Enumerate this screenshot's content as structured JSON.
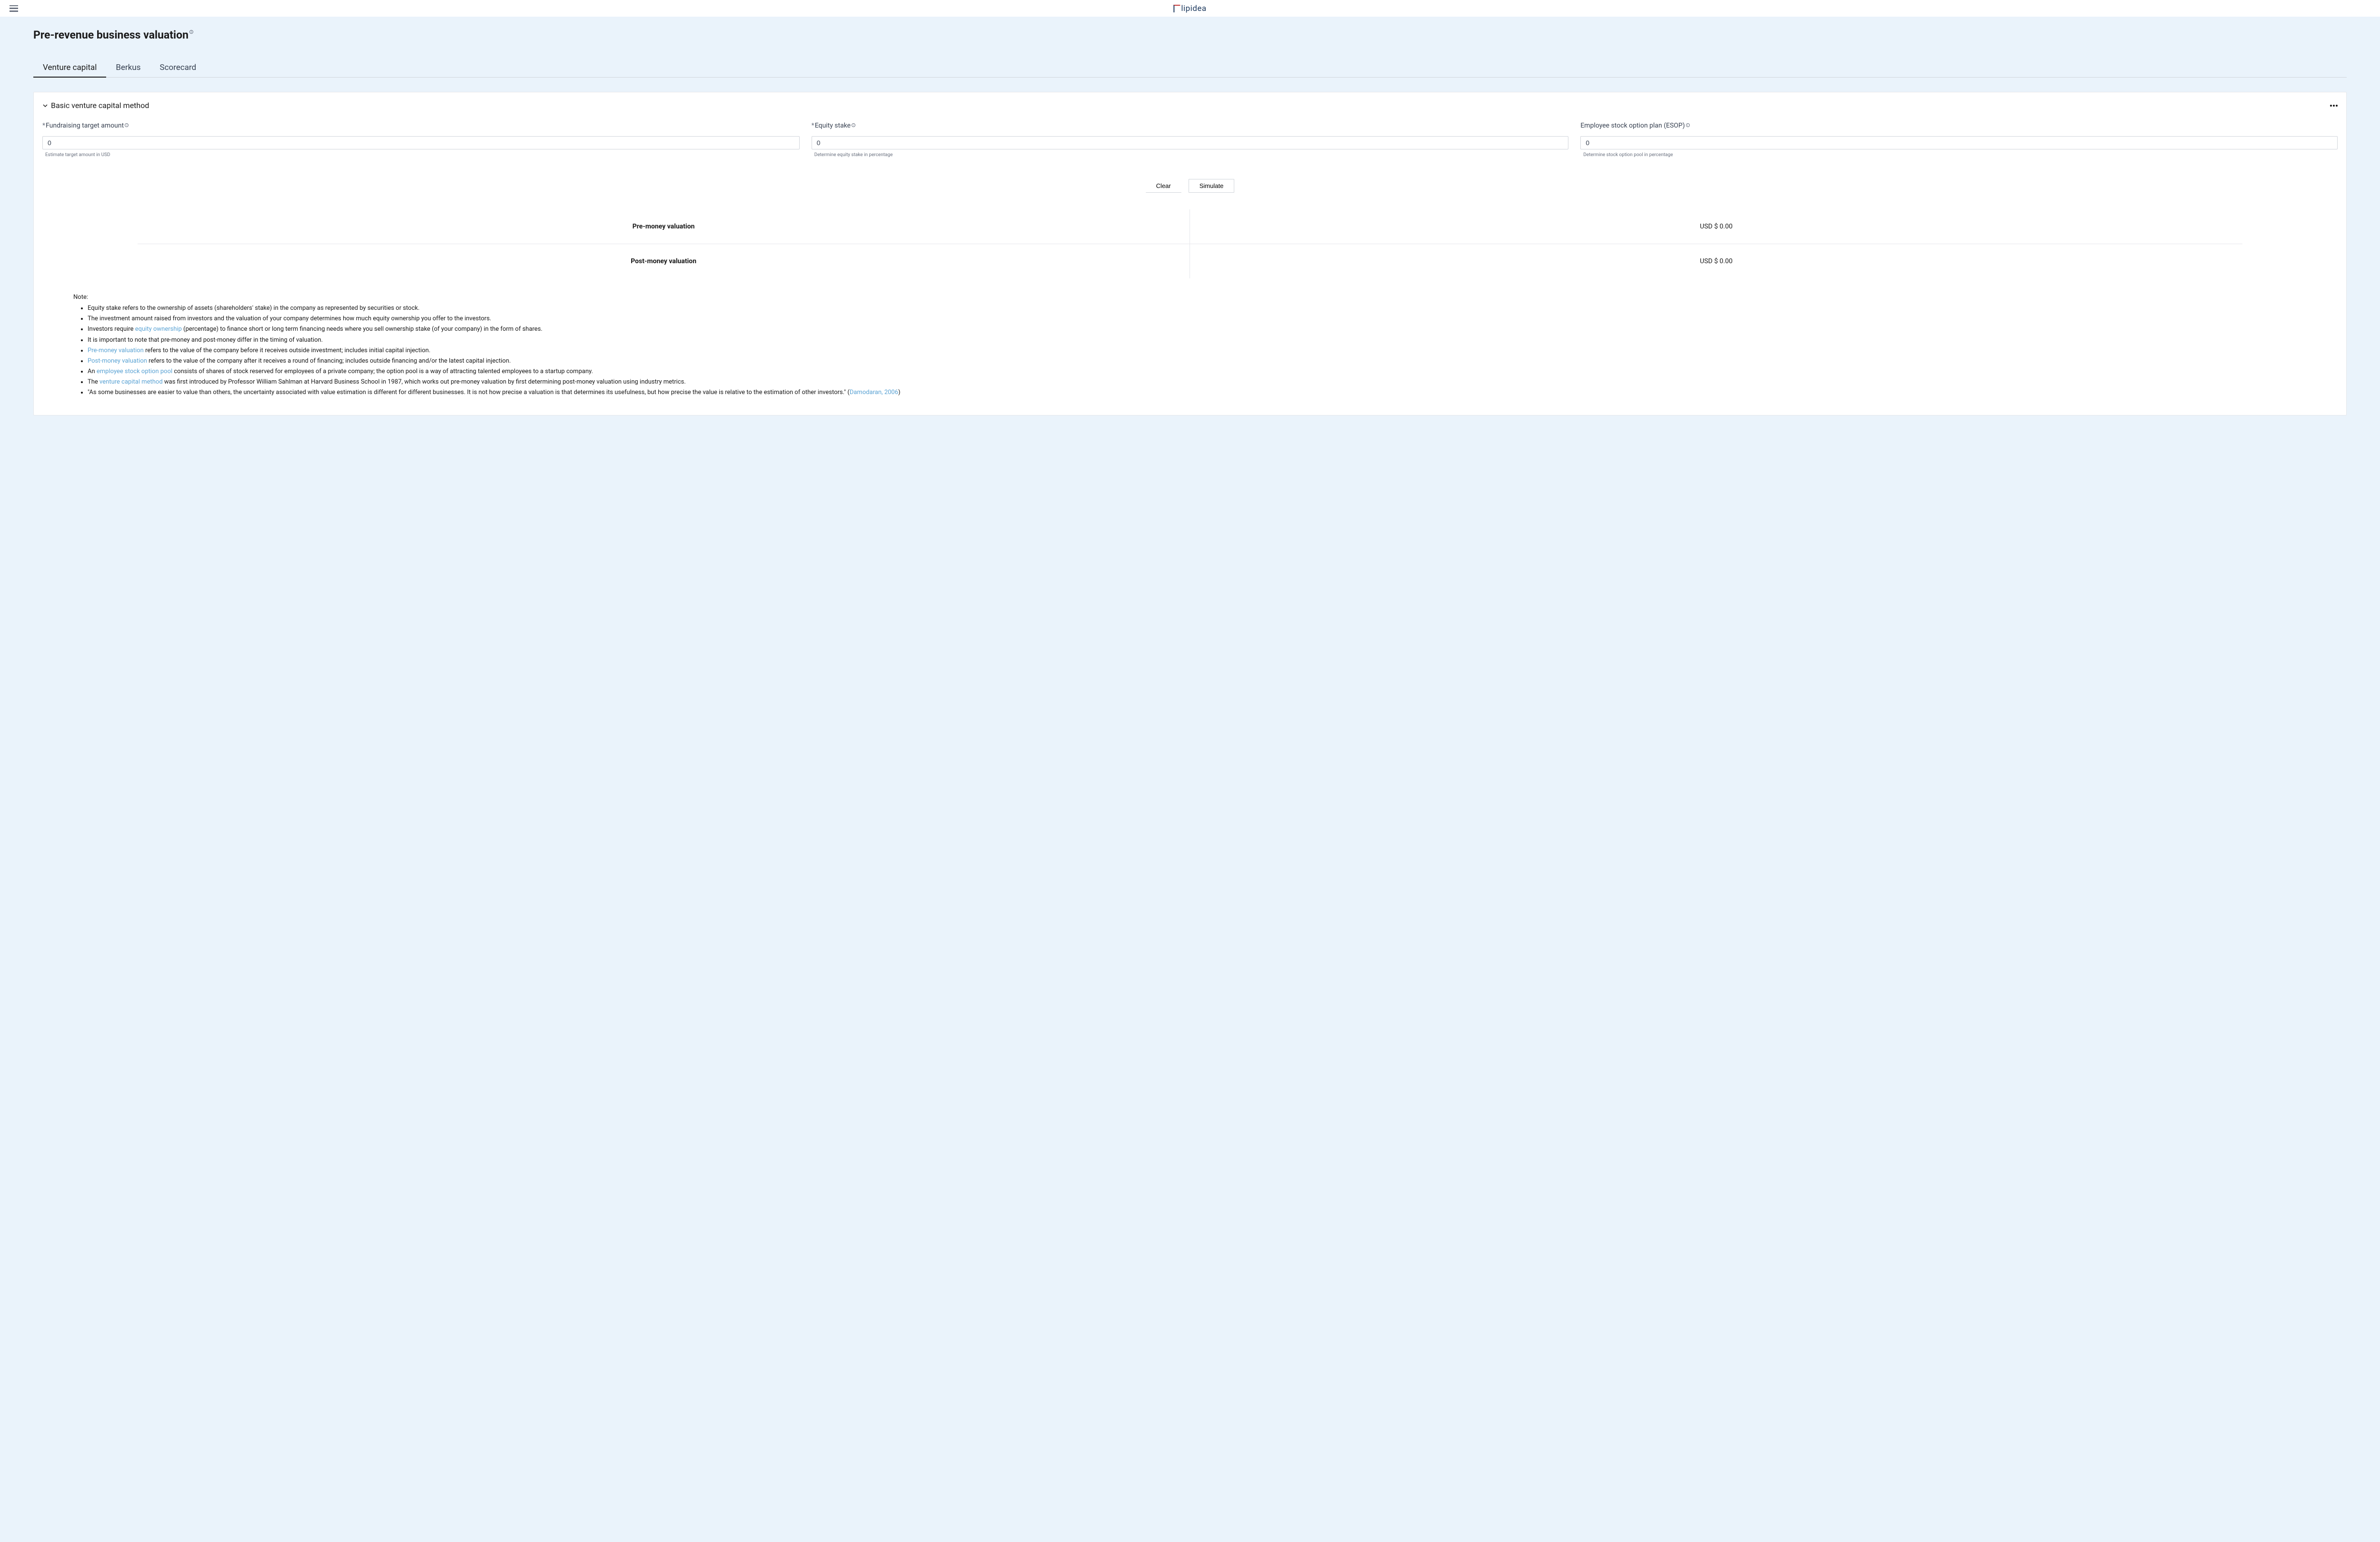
{
  "header": {
    "logo_text": "lipidea"
  },
  "page": {
    "title": "Pre-revenue business valuation"
  },
  "tabs": [
    {
      "label": "Venture capital",
      "active": true
    },
    {
      "label": "Berkus",
      "active": false
    },
    {
      "label": "Scorecard",
      "active": false
    }
  ],
  "card": {
    "title": "Basic venture capital method"
  },
  "form": {
    "fundraising": {
      "label": "Fundraising target amount",
      "value": "0",
      "hint": "Estimate target amount in USD",
      "required": true
    },
    "equity": {
      "label": "Equity stake",
      "value": "0",
      "hint": "Determine equity stake in percentage",
      "required": true
    },
    "esop": {
      "label": "Employee stock option plan (ESOP)",
      "value": "0",
      "hint": "Determine stock option pool in percentage",
      "required": false
    }
  },
  "buttons": {
    "clear": "Clear",
    "simulate": "Simulate"
  },
  "results": {
    "premoney": {
      "label": "Pre-money valuation",
      "value": "USD $ 0.00"
    },
    "postmoney": {
      "label": "Post-money valuation",
      "value": "USD $ 0.00"
    }
  },
  "notes": {
    "title": "Note:",
    "items": {
      "n1": "Equity stake refers to the ownership of assets (shareholders' stake) in the company as represented by securities or stock.",
      "n2": "The investment amount raised from investors and the valuation of your company determines how much equity ownership you offer to the investors.",
      "n3_a": "Investors require ",
      "n3_link": "equity ownership",
      "n3_b": " (percentage) to finance short or long term financing needs where you sell ownership stake (of your company) in the form of shares.",
      "n4": "It is important to note that pre-money and post-money differ in the timing of valuation.",
      "n5_link": "Pre-money valuation",
      "n5_b": " refers to the value of the company before it receives outside investment; includes initial capital injection.",
      "n6_link": "Post-money valuation",
      "n6_b": " refers to the value of the company after it receives a round of financing; includes outside financing and/or the latest capital injection.",
      "n7_a": "An ",
      "n7_link": "employee stock option pool",
      "n7_b": " consists of shares of stock reserved for employees of a private company; the option pool is a way of attracting talented employees to a startup company.",
      "n8_a": "The ",
      "n8_link": "venture capital method",
      "n8_b": " was first introduced by Professor William Sahlman at Harvard Business School in 1987, which works out pre-money valuation by first determining post-money valuation using industry metrics.",
      "n9_a": "\"As some businesses are easier to value than others, the uncertainty associated with value estimation is different for different businesses. It is not how precise a valuation is that determines its usefulness, but how precise the value is relative to the estimation of other investors.\" (",
      "n9_link": "Damodaran, 2006",
      "n9_b": ")"
    }
  }
}
